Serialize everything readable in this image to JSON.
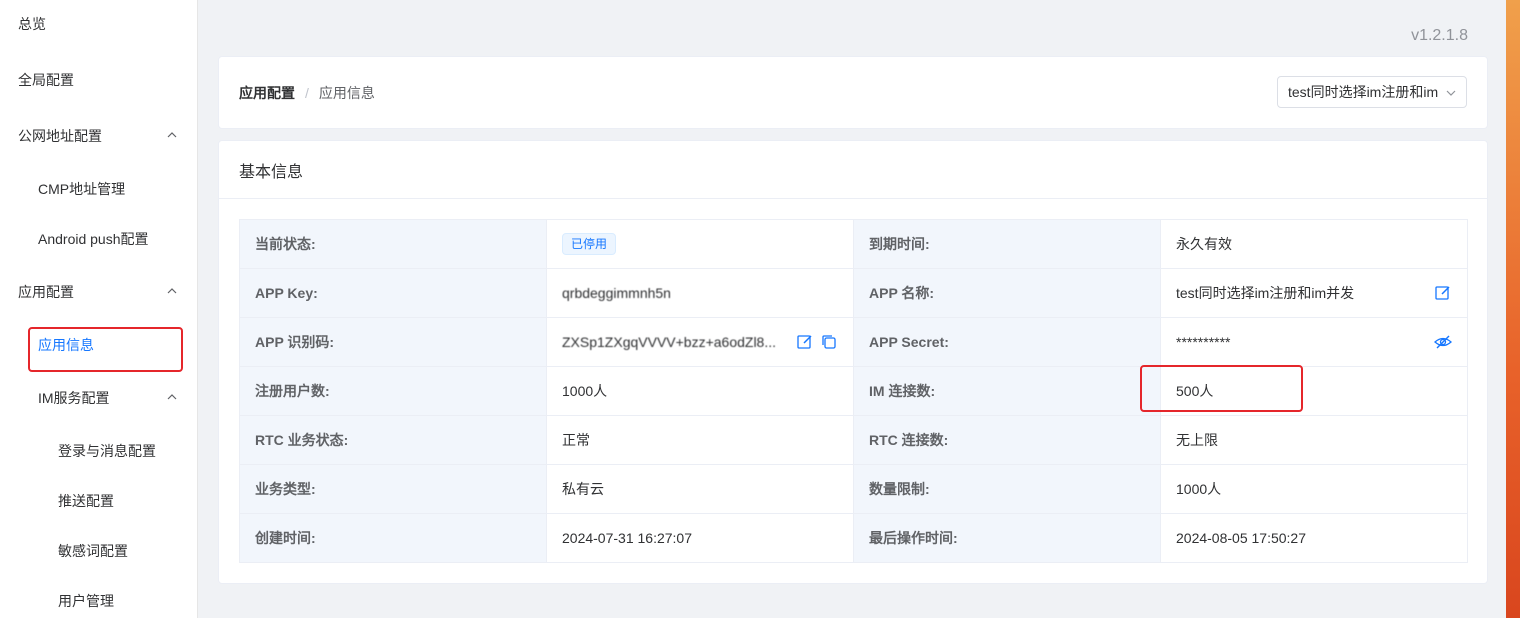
{
  "sidebar": {
    "items": [
      {
        "label": "总览"
      },
      {
        "label": "全局配置"
      },
      {
        "label": "公网地址配置"
      },
      {
        "label": "CMP地址管理"
      },
      {
        "label": "Android push配置"
      },
      {
        "label": "应用配置"
      },
      {
        "label": "应用信息"
      },
      {
        "label": "IM服务配置"
      },
      {
        "label": "登录与消息配置"
      },
      {
        "label": "推送配置"
      },
      {
        "label": "敏感词配置"
      },
      {
        "label": "用户管理"
      }
    ]
  },
  "version": "v1.2.1.8",
  "breadcrumb": {
    "first": "应用配置",
    "separator": "/",
    "second": "应用信息"
  },
  "app_select": {
    "value": "test同时选择im注册和im并发"
  },
  "card": {
    "title": "基本信息"
  },
  "info": {
    "rows": [
      {
        "label1": "当前状态:",
        "value1": "已停用",
        "label2": "到期时间:",
        "value2": "永久有效"
      },
      {
        "label1": "APP Key:",
        "value1": "qrbdeggimmnh5n",
        "label2": "APP 名称:",
        "value2": "test同时选择im注册和im并发"
      },
      {
        "label1": "APP 识别码:",
        "value1": "ZXSp1ZXgqVVVV+bzz+a6odZl8...",
        "label2": "APP Secret:",
        "value2": "**********"
      },
      {
        "label1": "注册用户数:",
        "value1": "1000人",
        "label2": "IM 连接数:",
        "value2": "500人"
      },
      {
        "label1": "RTC 业务状态:",
        "value1": "正常",
        "label2": "RTC 连接数:",
        "value2": "无上限"
      },
      {
        "label1": "业务类型:",
        "value1": "私有云",
        "label2": "数量限制:",
        "value2": "1000人"
      },
      {
        "label1": "创建时间:",
        "value1": "2024-07-31 16:27:07",
        "label2": "最后操作时间:",
        "value2": "2024-08-05 17:50:27"
      }
    ]
  },
  "colors": {
    "accent": "#1677ff",
    "highlight": "#e5262b",
    "label_bg": "#f2f6fc"
  },
  "icons": {
    "edit": "edit-icon",
    "copy": "copy-icon",
    "eye_off": "eye-off-icon",
    "chevron_up": "chevron-up-icon",
    "chevron_down": "chevron-down-icon"
  }
}
